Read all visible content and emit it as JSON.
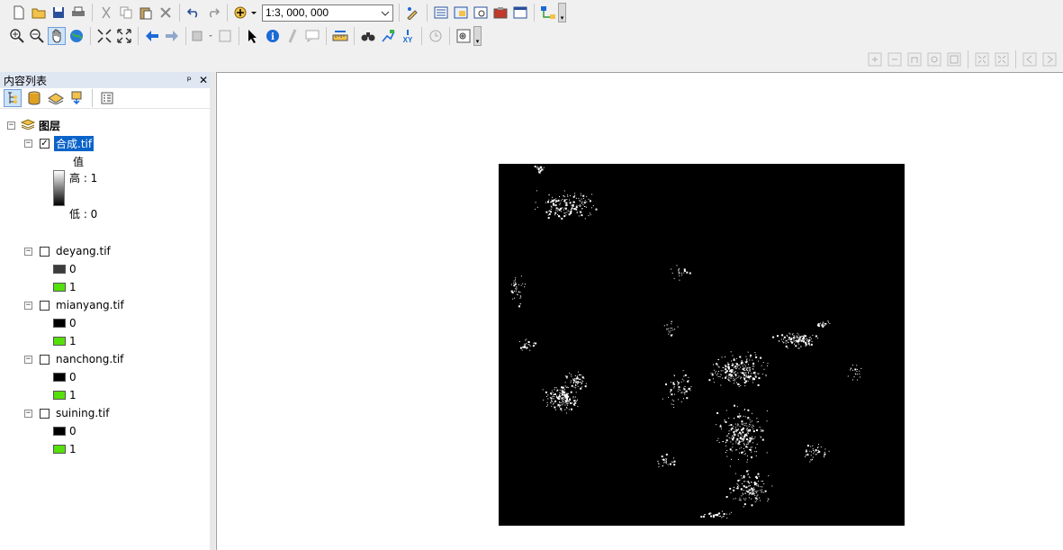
{
  "toolbar": {
    "scale_value": "1:3, 000, 000",
    "row1_icons": [
      "new-document-icon",
      "open-folder-icon",
      "save-icon",
      "print-icon",
      "cut-icon",
      "copy-icon",
      "paste-icon",
      "delete-icon",
      "undo-icon",
      "redo-icon",
      "add-data-icon"
    ],
    "row1_right_icons": [
      "editor-toolbar-icon",
      "toc-window-icon",
      "catalog-window-icon",
      "search-window-icon",
      "arctoolbox-icon",
      "python-window-icon",
      "model-builder-icon"
    ],
    "row2_icons": [
      "zoom-in-icon",
      "zoom-out-icon",
      "pan-icon",
      "full-extent-icon",
      "fixed-zoom-in-icon",
      "fixed-zoom-out-icon",
      "back-extent-icon",
      "forward-extent-icon",
      "select-features-icon",
      "clear-selection-icon",
      "select-elements-icon",
      "identify-icon",
      "hyperlink-icon",
      "html-popup-icon",
      "measure-icon",
      "find-icon",
      "find-route-icon",
      "go-to-xy-icon",
      "time-slider-icon",
      "viewer-window-icon"
    ]
  },
  "toc": {
    "title": "内容列表",
    "pin_symbol": "ᵖ",
    "close_symbol": "✕",
    "root_label": "图层",
    "composite_layer": {
      "name": "合成.tif",
      "checked": true,
      "legend_title": "值",
      "high_label": "高 : 1",
      "low_label": "低 : 0"
    },
    "layers": [
      {
        "name": "deyang.tif",
        "checked": false,
        "classes": [
          {
            "label": "0",
            "color": "#3c3c3c"
          },
          {
            "label": "1",
            "color": "#55e00c"
          }
        ]
      },
      {
        "name": "mianyang.tif",
        "checked": false,
        "classes": [
          {
            "label": "0",
            "color": "#000000"
          },
          {
            "label": "1",
            "color": "#55e00c"
          }
        ]
      },
      {
        "name": "nanchong.tif",
        "checked": false,
        "classes": [
          {
            "label": "0",
            "color": "#000000"
          },
          {
            "label": "1",
            "color": "#55e00c"
          }
        ]
      },
      {
        "name": "suining.tif",
        "checked": false,
        "classes": [
          {
            "label": "0",
            "color": "#000000"
          },
          {
            "label": "1",
            "color": "#55e00c"
          }
        ]
      }
    ]
  },
  "colors": {
    "selection": "#0a63c9",
    "raster_background": "#000000",
    "raster_foreground": "#ffffff"
  }
}
